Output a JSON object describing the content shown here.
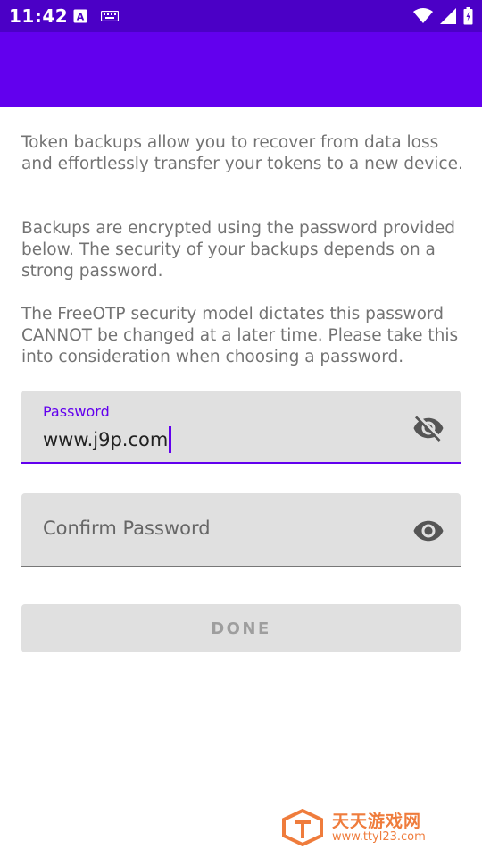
{
  "status_bar": {
    "time": "11:42",
    "icons": [
      "a-notification-icon",
      "keyboard-icon",
      "wifi-icon",
      "signal-icon",
      "battery-icon"
    ]
  },
  "colors": {
    "status_bar": "#4b00c6",
    "toolbar": "#6200ee",
    "accent": "#6200ee",
    "field_bg": "#e0e0e0",
    "button_bg": "#e0e0e0",
    "button_text": "#9e9e9e",
    "body_text": "#737373"
  },
  "content": {
    "paragraph1": "Token backups allow you to recover from data loss and effortlessly transfer your tokens to a new device.",
    "paragraph2": "Backups are encrypted using the password provided below. The security of your backups depends on a strong password.",
    "paragraph3": "The FreeOTP security model dictates this password CANNOT be changed at a later time. Please take this into consideration when choosing a password."
  },
  "password_field": {
    "label": "Password",
    "value": "www.j9p.com",
    "toggle_icon": "eye-off-icon"
  },
  "confirm_field": {
    "placeholder": "Confirm Password",
    "value": "",
    "toggle_icon": "eye-icon"
  },
  "done_button": {
    "label": "DONE",
    "enabled": false
  },
  "watermark": {
    "title": "天天游戏网",
    "url": "www.ttyl23.com"
  }
}
